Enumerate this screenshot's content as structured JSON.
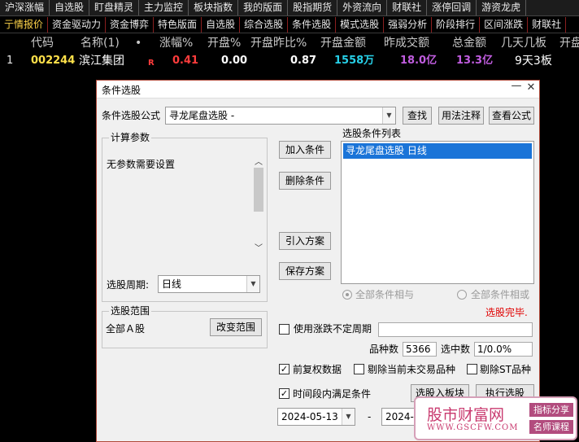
{
  "top_nav": [
    "沪深涨幅",
    "自选股",
    "盯盘精灵",
    "主力监控",
    "板块指数",
    "我的版面",
    "股指期货",
    "外资流向",
    "财联社",
    "涨停回调",
    "游资龙虎"
  ],
  "sub_nav": [
    {
      "label": "亍情报价",
      "active": true
    },
    {
      "label": "资金驱动力",
      "active": false
    },
    {
      "label": "资金博弈",
      "active": false
    },
    {
      "label": "特色版面",
      "active": false
    },
    {
      "label": "自选股",
      "active": false
    },
    {
      "label": "综合选股",
      "active": false
    },
    {
      "label": "条件选股",
      "active": false
    },
    {
      "label": "模式选股",
      "active": false
    },
    {
      "label": "强弱分析",
      "active": false
    },
    {
      "label": "阶段排行",
      "active": false
    },
    {
      "label": "区间涨跌",
      "active": false
    },
    {
      "label": "财联社",
      "active": false
    }
  ],
  "quote_header": [
    "代码",
    "名称(1)",
    "•",
    "涨幅%",
    "开盘%",
    "开盘昨比%",
    "开盘金额",
    "昨成交额",
    "总金额",
    "几天几板",
    "开盘"
  ],
  "quote_row": {
    "index": "1",
    "code": "002244",
    "name": "滨江集团",
    "flag": "R",
    "change_pct": "0.41",
    "open_pct": "0.00",
    "open_vs_prev": "0.87",
    "open_amount": "1558万",
    "prev_turnover": "18.0亿",
    "total_amount": "13.3亿",
    "boards": "9天3板"
  },
  "colors": {
    "red": "#ff3c3c",
    "yellow": "#ffe14a",
    "cyan": "#27d0e8",
    "purple": "#c15de0",
    "white": "#ffffff",
    "selection": "#1a74d8",
    "status_red": "#e00000"
  },
  "dialog": {
    "title": "条件选股",
    "formula_label": "条件选股公式",
    "formula_value": "寻龙尾盘选股  -",
    "find_button": "查找",
    "usage_button": "用法注释",
    "view_formula_button": "查看公式",
    "params_group_title": "计算参数",
    "params_text": "无参数需要设置",
    "period_label": "选股周期:",
    "period_value": "日线",
    "add_condition": "加入条件",
    "delete_condition": "删除条件",
    "import_plan": "引入方案",
    "save_plan": "保存方案",
    "condition_list_title": "选股条件列表",
    "conditions": [
      "寻龙尾盘选股  日线"
    ],
    "logic_and": "全部条件相与",
    "logic_or": "全部条件相或",
    "status": "选股完毕.",
    "range_group_title": "选股范围",
    "range_value": "全部Ａ股",
    "change_range_button": "改变范围",
    "use_variable_period": "使用涨跌不定周期",
    "variable_period_value": "",
    "count_label": "品种数",
    "count_value": "5366",
    "selected_label": "选中数",
    "selected_value": "1/0.0%",
    "checkbox_adjusted": "前复权数据",
    "checkbox_adjusted_checked": true,
    "checkbox_exclude_untraded": "剔除当前未交易品种",
    "checkbox_exclude_untraded_checked": false,
    "checkbox_exclude_st": "剔除ST品种",
    "checkbox_exclude_st_checked": false,
    "checkbox_time_range": "时间段内满足条件",
    "checkbox_time_range_checked": true,
    "to_block_button": "选股入板块",
    "execute_button": "执行选股",
    "date_from": "2024-05-13",
    "date_sep": "-",
    "date_to": "2024-05"
  },
  "watermark": {
    "title": "股市财富网",
    "url": "WWW.GSCFW.COM",
    "tag1": "指标分享",
    "tag2": "名师课程"
  }
}
